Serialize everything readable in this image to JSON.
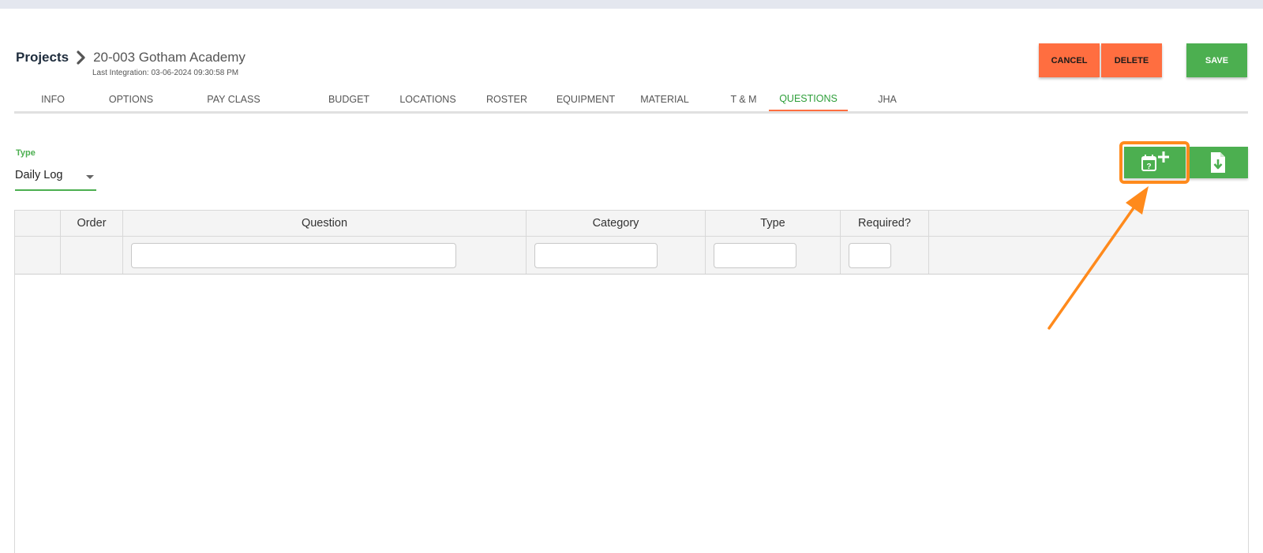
{
  "breadcrumb": {
    "root": "Projects",
    "project": "20-003 Gotham Academy",
    "last_integration": "Last Integration: 03-06-2024 09:30:58 PM"
  },
  "actions": {
    "cancel": "CANCEL",
    "delete": "DELETE",
    "save": "SAVE"
  },
  "tabs": [
    {
      "label": "INFO"
    },
    {
      "label": "OPTIONS"
    },
    {
      "label": "PAY CLASS"
    },
    {
      "label": "BUDGET"
    },
    {
      "label": "LOCATIONS"
    },
    {
      "label": "ROSTER"
    },
    {
      "label": "EQUIPMENT"
    },
    {
      "label": "MATERIAL"
    },
    {
      "label": "T & M"
    },
    {
      "label": "QUESTIONS",
      "active": true
    },
    {
      "label": "JHA"
    }
  ],
  "type_filter": {
    "label": "Type",
    "value": "Daily Log"
  },
  "toolbar": {
    "add_question_icon": "calendar-question-plus-icon",
    "import_icon": "file-download-icon"
  },
  "grid": {
    "columns": [
      "",
      "Order",
      "Question",
      "Category",
      "Type",
      "Required?",
      ""
    ]
  },
  "colors": {
    "accent_green": "#4caf50",
    "active_tab": "#2e9f3a",
    "danger_orange": "#ff6e40",
    "annotation_orange": "#ff8a1c"
  }
}
